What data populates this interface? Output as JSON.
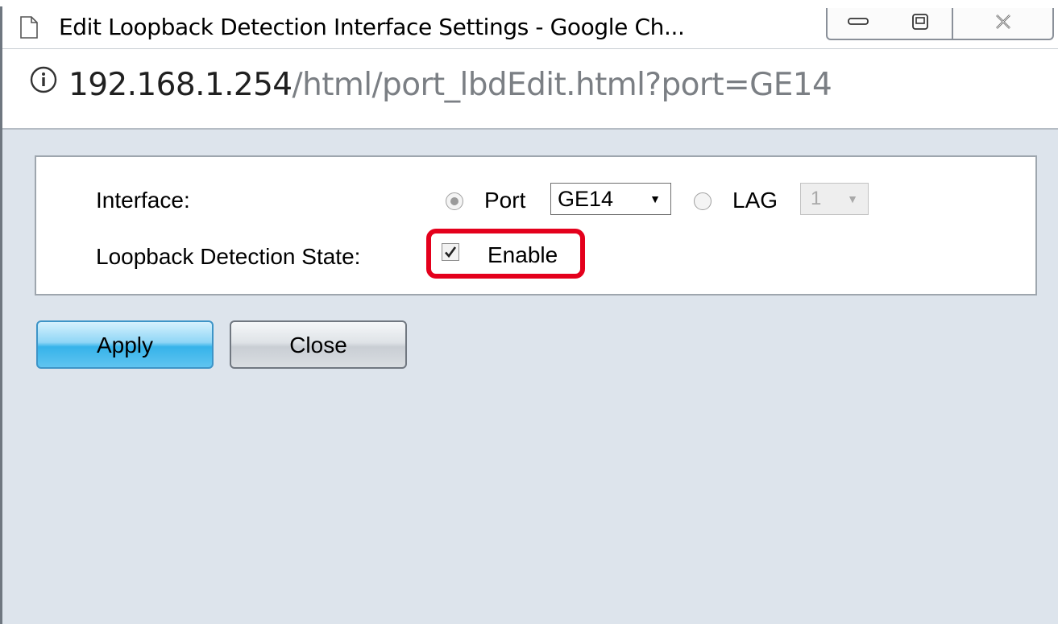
{
  "window": {
    "title": "Edit Loopback Detection Interface Settings - Google Ch...",
    "icons": {
      "page": "page-icon",
      "minimize": "minimize-icon",
      "maximize": "maximize-icon",
      "close": "close-icon"
    }
  },
  "address": {
    "host": "192.168.1.254",
    "path": "/html/port_lbdEdit.html?port=GE14",
    "icon": "info-icon"
  },
  "form": {
    "interface_label": "Interface:",
    "port_option_label": "Port",
    "port_selected": true,
    "port_value": "GE14",
    "lag_option_label": "LAG",
    "lag_selected": false,
    "lag_value": "1",
    "lbd_state_label": "Loopback Detection State:",
    "enable_label": "Enable",
    "enable_checked": true,
    "highlight_color": "#e4001c"
  },
  "buttons": {
    "apply_label": "Apply",
    "close_label": "Close",
    "apply_color": "#36b3ea"
  }
}
